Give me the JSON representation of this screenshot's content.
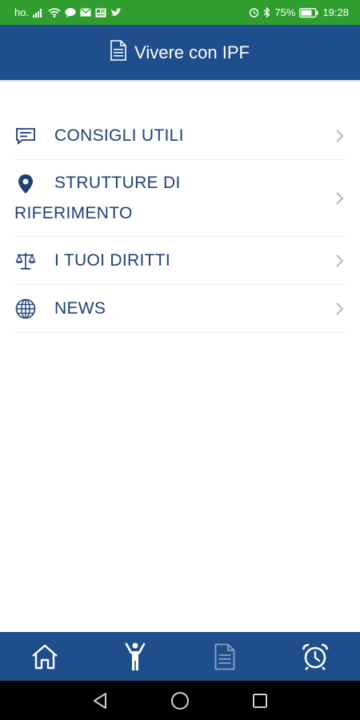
{
  "status_bar": {
    "carrier": "ho.",
    "battery": "75%",
    "time": "19:28",
    "icons": [
      "signal-icon",
      "wifi-icon",
      "chat-icon",
      "mail-icon",
      "news-icon",
      "twitter-icon",
      "alarm-icon",
      "bluetooth-icon",
      "battery-icon"
    ]
  },
  "header": {
    "title": "Vivere con IPF",
    "icon": "document-icon"
  },
  "menu": {
    "items": [
      {
        "label": "CONSIGLI UTILI",
        "icon": "message-icon"
      },
      {
        "label": "STRUTTURE DI RIFERIMENTO",
        "icon": "location-pin-icon"
      },
      {
        "label": "I TUOI DIRITTI",
        "icon": "scales-icon"
      },
      {
        "label": "NEWS",
        "icon": "globe-icon"
      }
    ]
  },
  "tab_bar": {
    "tabs": [
      {
        "icon": "home-icon",
        "active": true
      },
      {
        "icon": "person-icon",
        "active": true
      },
      {
        "icon": "document-icon",
        "active": false
      },
      {
        "icon": "alarm-clock-icon",
        "active": true
      }
    ]
  },
  "colors": {
    "status_bar": "#2f9e2f",
    "primary": "#1f4e8c",
    "menu_text": "#1f3f7a",
    "divider": "#ececec",
    "chevron": "#b5b5b5",
    "inactive_tab": "#8aa2c4"
  }
}
